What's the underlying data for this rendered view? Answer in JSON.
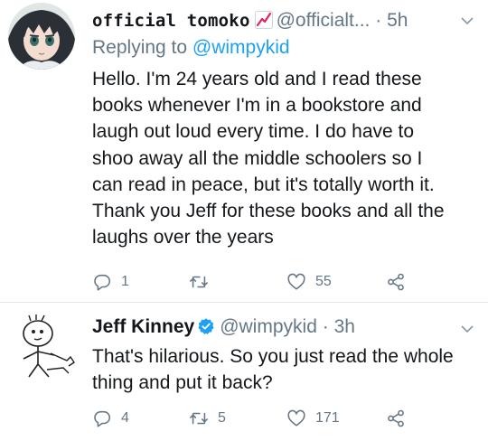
{
  "tweets": [
    {
      "display_name": "official tomoko",
      "name_emoji": "chart-increasing-icon",
      "handle": "@officialt...",
      "separator": "·",
      "time": "5h",
      "replying_label": "Replying to",
      "replying_mention": "@wimpykid",
      "body_lines": [
        "Hello. I'm 24 years old and I read these",
        "books whenever I'm in a bookstore and",
        "laugh out loud every time. I do have to",
        "shoo away all the middle schoolers so I",
        "can read in peace, but it's totally worth it.",
        "Thank you Jeff for these books and all the",
        "laughs over the years"
      ],
      "reply_count": "1",
      "retweet_count": "",
      "like_count": "55"
    },
    {
      "display_name": "Jeff Kinney",
      "verified": true,
      "handle": "@wimpykid",
      "separator": "·",
      "time": "3h",
      "body_lines": [
        "That's hilarious. So you just read the whole",
        "thing and put it back?"
      ],
      "reply_count": "4",
      "retweet_count": "5",
      "like_count": "171"
    }
  ],
  "colors": {
    "text": "#14171a",
    "secondary": "#657786",
    "link": "#1da1f2",
    "verified": "#1da1f2",
    "divider": "#e1e8ed",
    "chart_emoji": "#e0245e"
  },
  "icons": [
    "reply-icon",
    "retweet-icon",
    "like-icon",
    "share-icon",
    "chevron-down-icon",
    "verified-icon"
  ]
}
